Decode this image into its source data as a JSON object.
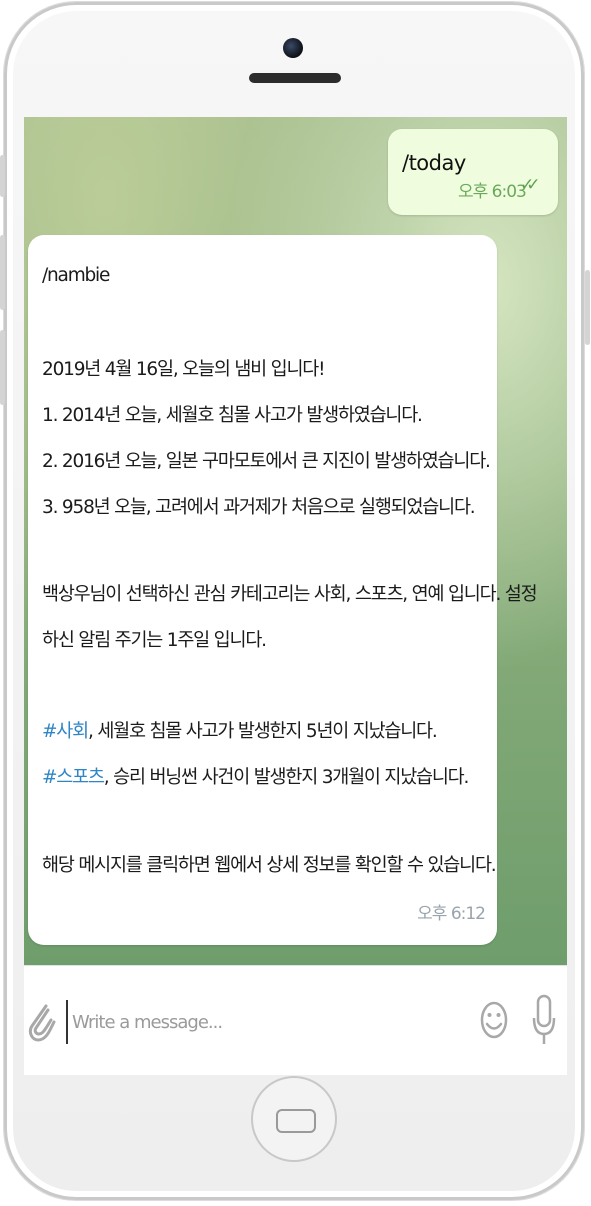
{
  "outgoing": {
    "text": "/today",
    "time": "오후 6:03",
    "status_icon": "double-check-icon"
  },
  "incoming": {
    "lines": [
      "/nambie",
      "2019년 4월 16일, 오늘의 냄비 입니다!",
      "1. 2014년 오늘, 세월호 침몰 사고가 발생하였습니다.",
      "2. 2016년 오늘, 일본 구마모토에서 큰 지진이 발생하였습니다.",
      "3. 958년 오늘, 고려에서 과거제가 처음으로 실행되었습니다.",
      "백상우님이 선택하신 관심 카테고리는 사회, 스포츠, 연예 입니다. 설정",
      "하신 알림 주기는 1주일 입니다.",
      "해당 메시지를 클릭하면 웹에서 상세 정보를 확인할 수 있습니다."
    ],
    "tags": [
      {
        "tag": "#사회",
        "text": ", 세월호 침몰 사고가 발생한지 5년이 지났습니다."
      },
      {
        "tag": "#스포츠",
        "text": ", 승리 버닝썬 사건이 발생한지 3개월이 지났습니다."
      }
    ],
    "time": "오후 6:12"
  },
  "composer": {
    "placeholder": "Write a message...",
    "icons": [
      "paperclip-icon",
      "emoji-icon",
      "microphone-icon"
    ]
  },
  "colors": {
    "hashtag": "#2f86c6",
    "outgoing_bubble": "#effdde",
    "outgoing_time": "#6aa95a"
  }
}
